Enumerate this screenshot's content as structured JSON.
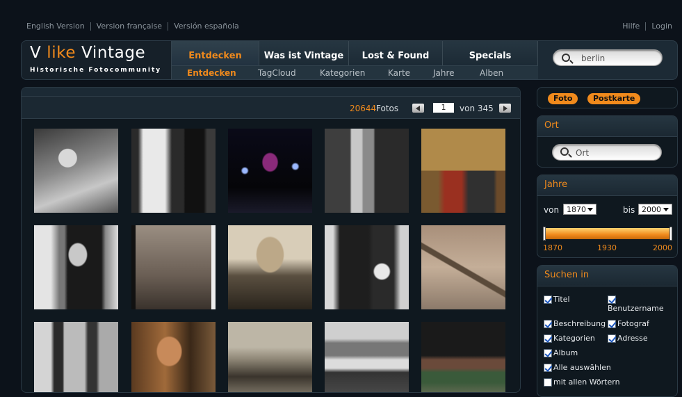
{
  "langs": [
    "English Version",
    "Version française",
    "Versión española"
  ],
  "utils": {
    "help": "Hilfe",
    "login": "Login"
  },
  "logo": {
    "v": "V",
    "like": "like",
    "vintage": "Vintage",
    "subtitle": "Historische Fotocommunity"
  },
  "nav": {
    "top": [
      "Entdecken",
      "Was ist Vintage",
      "Lost & Found",
      "Specials"
    ],
    "sub": [
      "Entdecken",
      "TagCloud",
      "Kategorien",
      "Karte",
      "Jahre",
      "Alben"
    ]
  },
  "search": {
    "value": "berlin"
  },
  "pager": {
    "count": "20644",
    "fotos_label": "Fotos",
    "page": "1",
    "of_label": "von 345"
  },
  "photos": [
    "photo-woman-portrait",
    "photo-wedding-couple",
    "photo-stage-performer",
    "photo-elderly-couple-room",
    "photo-couple-sofa",
    "photo-man-uniform",
    "photo-children-beach",
    "photo-man-bowtie",
    "photo-family-portrait",
    "photo-model-railway",
    "photo-legs",
    "photo-guitarist",
    "photo-group-beach",
    "photo-berliner-club",
    "photo-model-town"
  ],
  "filters": {
    "type_tags": [
      "Foto",
      "Postkarte"
    ],
    "ort": {
      "title": "Ort",
      "placeholder": "Ort"
    },
    "jahre": {
      "title": "Jahre",
      "from_label": "von",
      "from": "1870",
      "to_label": "bis",
      "to": "2000",
      "ticks": [
        "1870",
        "1930",
        "2000"
      ]
    },
    "search_in": {
      "title": "Suchen in",
      "options": [
        {
          "label": "Titel",
          "checked": true
        },
        {
          "label": "Benutzername",
          "checked": true
        },
        {
          "label": "Beschreibung",
          "checked": true
        },
        {
          "label": "Fotograf",
          "checked": true
        },
        {
          "label": "Kategorien",
          "checked": true
        },
        {
          "label": "Adresse",
          "checked": true
        },
        {
          "label": "Album",
          "checked": true
        },
        {
          "label": "Alle auswählen",
          "checked": true
        },
        {
          "label": "mit allen Wörtern",
          "checked": false
        }
      ]
    }
  },
  "colors": {
    "accent": "#f08a1c",
    "bg": "#0c121a",
    "panel": "#1c2a35"
  }
}
